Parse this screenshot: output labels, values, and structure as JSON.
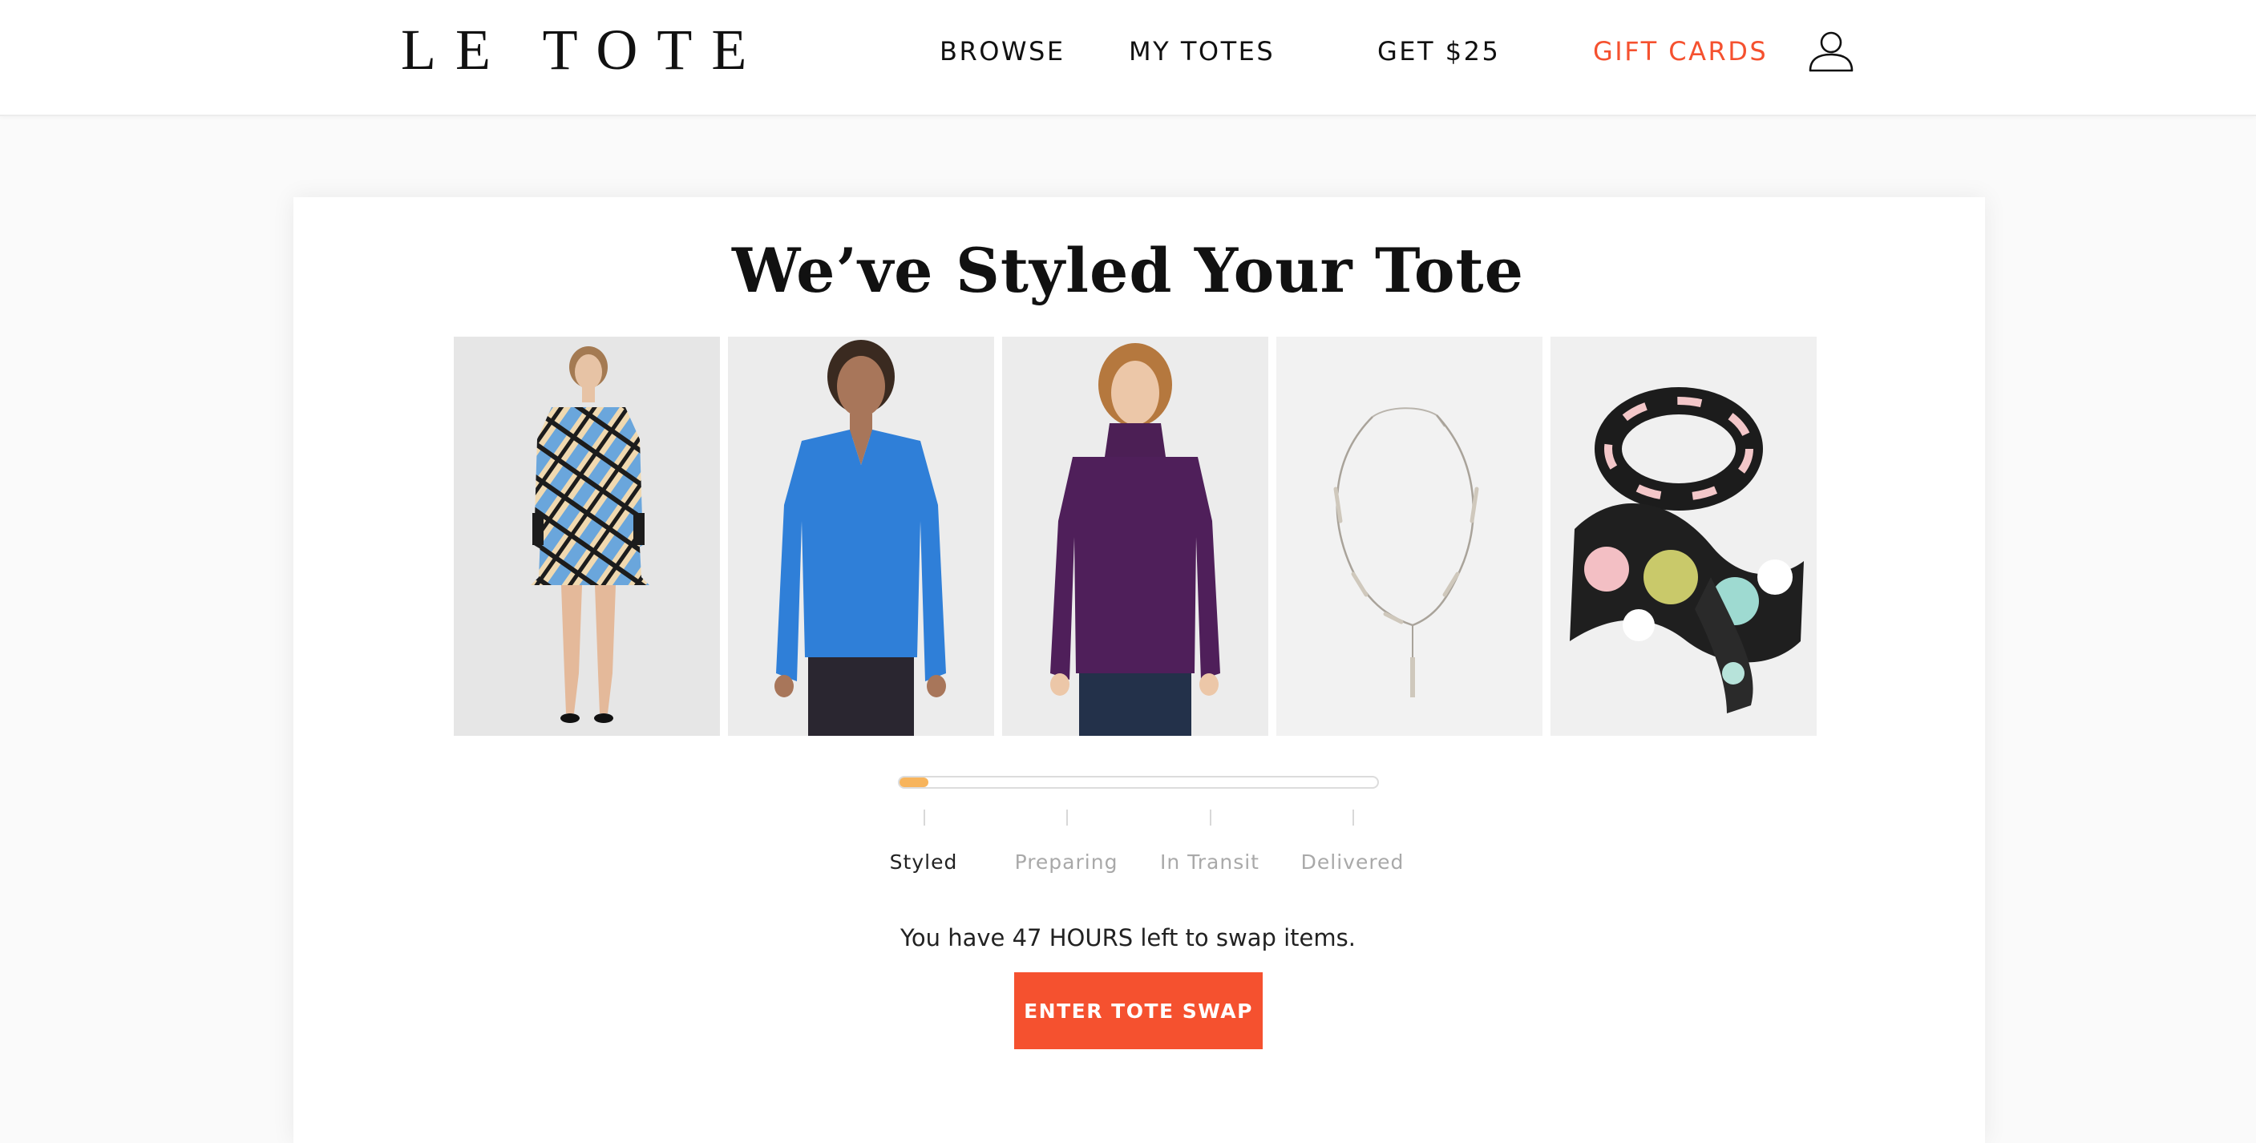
{
  "header": {
    "logo": "LE TOTE",
    "nav": [
      {
        "label": "BROWSE"
      },
      {
        "label": "MY TOTES"
      },
      {
        "label": "GET $25"
      },
      {
        "label": "GIFT CARDS",
        "color": "#f5512f"
      }
    ],
    "account_icon": "user-outline-icon"
  },
  "tote": {
    "title": "We’ve Styled Your Tote",
    "items": [
      {
        "name": "plaid-long-sleeve-dress"
      },
      {
        "name": "blue-v-neck-long-sleeve-top"
      },
      {
        "name": "purple-cowl-neck-long-sleeve-top"
      },
      {
        "name": "silver-lariat-necklace"
      },
      {
        "name": "floral-print-scarf"
      }
    ],
    "progress": {
      "fraction": 0.06,
      "stages": [
        {
          "label": "Styled",
          "active": true
        },
        {
          "label": "Preparing",
          "active": false
        },
        {
          "label": "In Transit",
          "active": false
        },
        {
          "label": "Delivered",
          "active": false
        }
      ],
      "fill_color": "#f7b45c"
    },
    "swap_message": "You have 47 HOURS left to swap items.",
    "swap_button": "ENTER TOTE SWAP",
    "accent_color": "#f5512f"
  }
}
